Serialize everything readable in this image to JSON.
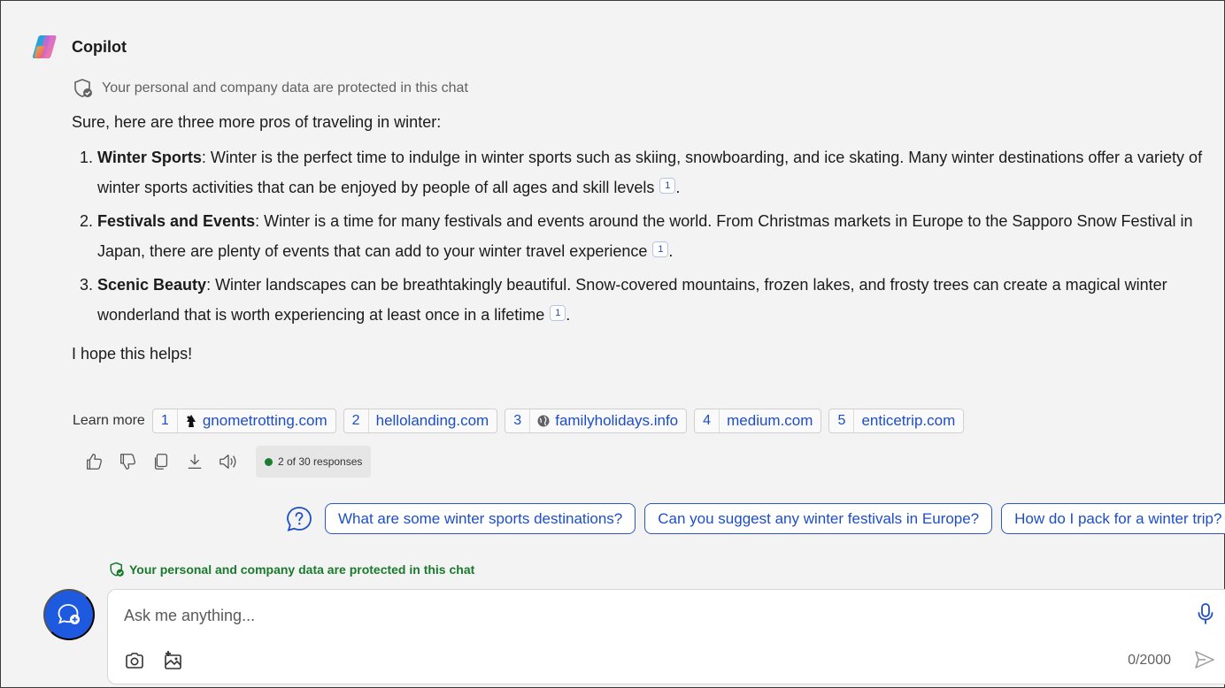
{
  "app": {
    "title": "Copilot"
  },
  "privacy_top": "Your personal and company data are protected in this chat",
  "response": {
    "intro": "Sure, here are three more pros of traveling in winter:",
    "items": [
      {
        "title": "Winter Sports",
        "text": ": Winter is the perfect time to indulge in winter sports such as skiing, snowboarding, and ice skating. Many winter destinations offer a variety of winter sports activities that can be enjoyed by people of all ages and skill levels",
        "cite": "1"
      },
      {
        "title": "Festivals and Events",
        "text": ": Winter is a time for many festivals and events around the world. From Christmas markets in Europe to the Sapporo Snow Festival in Japan, there are plenty of events that can add to your winter travel experience",
        "cite": "1"
      },
      {
        "title": "Scenic Beauty",
        "text": ": Winter landscapes can be breathtakingly beautiful. Snow-covered mountains, frozen lakes, and frosty trees can create a magical winter wonderland that is worth experiencing at least once in a lifetime",
        "cite": "1"
      }
    ],
    "closing": "I hope this helps!"
  },
  "learn_more": {
    "label": "Learn more",
    "sources": [
      {
        "num": "1",
        "domain": "gnometrotting.com",
        "favicon": "gnome-favicon"
      },
      {
        "num": "2",
        "domain": "hellolanding.com",
        "favicon": ""
      },
      {
        "num": "3",
        "domain": "familyholidays.info",
        "favicon": "globe-icon"
      },
      {
        "num": "4",
        "domain": "medium.com",
        "favicon": ""
      },
      {
        "num": "5",
        "domain": "enticetrip.com",
        "favicon": ""
      }
    ]
  },
  "response_counter": "2 of 30 responses",
  "suggestions": [
    "What are some winter sports destinations?",
    "Can you suggest any winter festivals in Europe?",
    "How do I pack for a winter trip?"
  ],
  "privacy_bottom": "Your personal and company data are protected in this chat",
  "composer": {
    "placeholder": "Ask me anything...",
    "char_count": "0/2000"
  },
  "colors": {
    "accent": "#1d4dc9",
    "new_topic_button": "#1e5ae0",
    "privacy_green": "#197a2c"
  }
}
